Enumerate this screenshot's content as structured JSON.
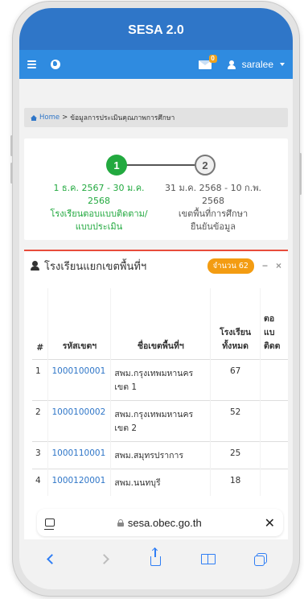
{
  "app": {
    "title": "SESA 2.0"
  },
  "navbar": {
    "mail_count": "0",
    "username": "saralee"
  },
  "breadcrumb": {
    "home": "Home",
    "separator": ">",
    "current": "ข้อมูลการประเมินคุณภาพการศึกษา"
  },
  "stepper": {
    "step1": {
      "number": "1",
      "date_line1": "1 ธ.ค. 2567 - 30 ม.ค.",
      "date_line2": "2568",
      "desc_line1": "โรงเรียนตอบแบบติดตาม/",
      "desc_line2": "แบบประเมิน"
    },
    "step2": {
      "number": "2",
      "date_line1": "31 ม.ค. 2568 - 10 ก.พ.",
      "date_line2": "2568",
      "desc_line1": "เขตพื้นที่การศึกษา",
      "desc_line2": "ยืนยันข้อมูล"
    }
  },
  "school_card": {
    "title": "โรงเรียนแยกเขตพื้นที่ฯ",
    "count_badge": "จำนวน 62",
    "minimize": "−",
    "close": "×",
    "table": {
      "headers": {
        "num": "#",
        "code": "รหัสเขตฯ",
        "name": "ชื่อเขตพื้นที่ฯ",
        "total_l1": "โรงเรียน",
        "total_l2": "ทั้งหมด",
        "extra_l1": "ตอ",
        "extra_l2": "แบ",
        "extra_l3": "ติดต"
      },
      "rows": [
        {
          "num": "1",
          "code": "1000100001",
          "name_l1": "สพม.กรุงเทพมหานคร",
          "name_l2": "เขต 1",
          "total": "67"
        },
        {
          "num": "2",
          "code": "1000100002",
          "name_l1": "สพม.กรุงเทพมหานคร",
          "name_l2": "เขต 2",
          "total": "52"
        },
        {
          "num": "3",
          "code": "1000110001",
          "name_l1": "สพม.สมุทรปราการ",
          "name_l2": "",
          "total": "25"
        },
        {
          "num": "4",
          "code": "1000120001",
          "name_l1": "สพม.นนทบุรี",
          "name_l2": "",
          "total": "18"
        }
      ]
    }
  },
  "browser": {
    "url": "sesa.obec.go.th",
    "close": "✕"
  },
  "colors": {
    "title_bar": "#2f76c8",
    "navbar": "#2f8be0",
    "step_active": "#22a93f",
    "badge": "#f39c12",
    "card_border": "#e74c3c",
    "safari_blue": "#2f7ef5"
  }
}
